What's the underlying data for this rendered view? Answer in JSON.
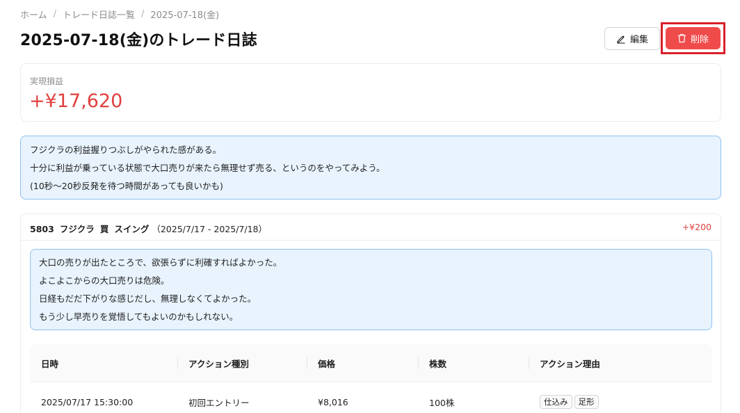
{
  "breadcrumb": {
    "home": "ホーム",
    "list": "トレード日誌一覧",
    "current": "2025-07-18(金)",
    "separator": "/"
  },
  "page_title": "2025-07-18(金)のトレード日誌",
  "actions": {
    "edit_label": "編集",
    "delete_label": "削除"
  },
  "pnl": {
    "label": "実現損益",
    "value": "+¥17,620"
  },
  "day_note": [
    "フジクラの利益握りつぶしがやられた感がある。",
    "十分に利益が乗っている状態で大口売りが来たら無理せず売る、というのをやってみよう。",
    "(10秒〜20秒反発を待つ時間があっても良いかも)"
  ],
  "trade": {
    "code": "5803",
    "name": "フジクラ",
    "side": "買",
    "style": "スイング",
    "period": "（2025/7/17 - 2025/7/18）",
    "pnl": "+¥200",
    "note": [
      "大口の売りが出たところで、欲張らずに利確すればよかった。",
      "よこよこからの大口売りは危険。",
      "日経もだだ下がりな感じだし、無理しなくてよかった。",
      "もう少し早売りを覚悟してもよいのかもしれない。"
    ],
    "table": {
      "headers": [
        "日時",
        "アクション種別",
        "価格",
        "株数",
        "アクション理由"
      ],
      "rows": [
        {
          "datetime": "2025/07/17 15:30:00",
          "action": "初回エントリー",
          "price": "¥8,016",
          "shares": "100株",
          "reasons": [
            "仕込み",
            "足形"
          ]
        }
      ]
    }
  },
  "colors": {
    "profit": "#e0413f",
    "delete_button": "#f04b4b",
    "highlight_border": "#d8202a",
    "note_bg": "#e8f3fe",
    "note_border": "#8ec1ef"
  }
}
